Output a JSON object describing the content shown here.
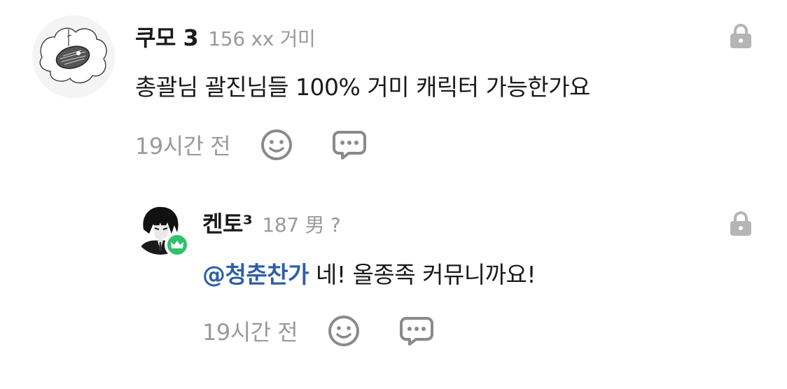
{
  "comments": [
    {
      "username": "쿠모 3",
      "user_info": "156 xx 거미",
      "text": "총괄님 괄진님들 100% 거미 캐릭터 가능한가요",
      "time": "19시간 전",
      "avatar": "sketch-avatar-icon",
      "actions": [
        "emoji-reaction-icon",
        "reply-comment-icon"
      ],
      "locked": true
    },
    {
      "username": "켄토³",
      "user_info": "187 男 ?",
      "mention": "@청춘찬가",
      "text": "네! 올종족 커뮤니까요!",
      "time": "19시간 전",
      "avatar": "dark-character-avatar-icon",
      "badge": "crown-icon",
      "actions": [
        "emoji-reaction-icon",
        "reply-comment-icon"
      ],
      "locked": true
    }
  ],
  "colors": {
    "text": "#1a1a1a",
    "muted": "#9a9a9a",
    "mention": "#2f5ea8",
    "badge": "#2ec26b",
    "icon": "#8a8a8a",
    "lock": "#b5b5b5"
  }
}
